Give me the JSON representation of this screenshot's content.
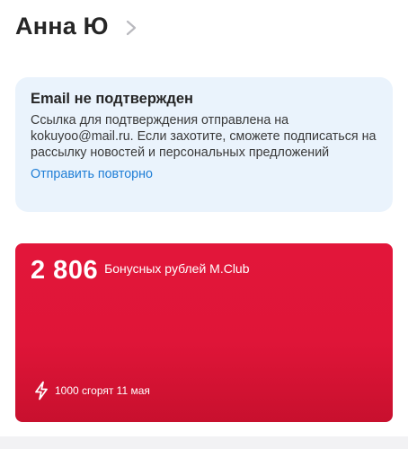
{
  "profile": {
    "name": "Анна Ю"
  },
  "email_notice": {
    "title": "Email не подтвержден",
    "message": "Ссылка для подтверждения отправлена на kokuyoo@mail.ru. Если захотите, сможете подписаться на рассылку новостей и персональных предложений",
    "resend_label": "Отправить повторно"
  },
  "bonus": {
    "amount": "2 806",
    "label": "Бонусных рублей M.Club",
    "expiry_text": "1000 сгорят 11 мая"
  },
  "colors": {
    "accent_link": "#1f7ed6",
    "notice_background": "#eaf3fc",
    "bonus_card": "#e2163a"
  },
  "icons": {
    "header_chevron": "chevron-right-icon",
    "expiry": "lightning-bolt-icon"
  }
}
